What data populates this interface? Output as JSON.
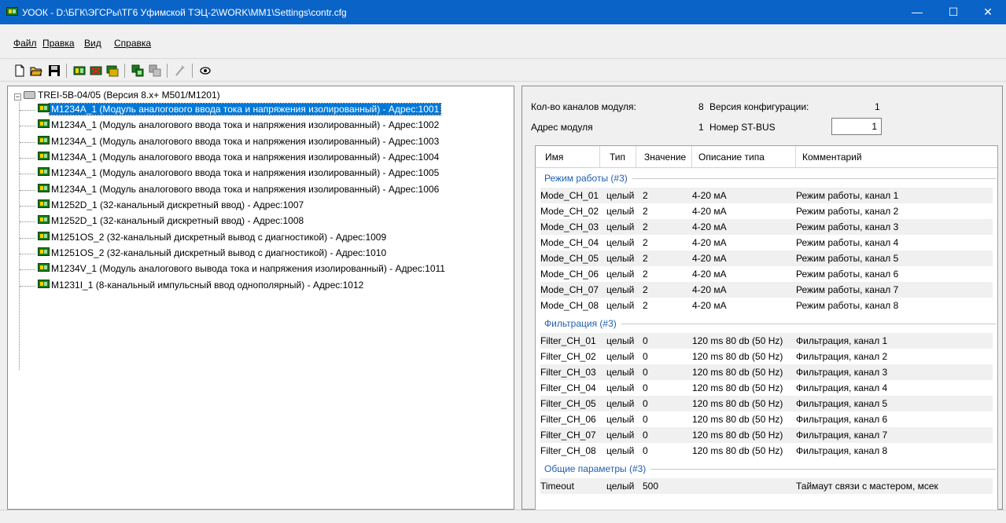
{
  "window": {
    "title": "УООК - D:\\БГК\\ЭГСРы\\ТГ6 Уфимской ТЭЦ-2\\WORK\\MM1\\Settings\\contr.cfg",
    "minimize_glyph": "—",
    "maximize_glyph": "☐",
    "close_glyph": "✕"
  },
  "menu": {
    "file": "Файл",
    "edit": "Правка",
    "view": "Вид",
    "help": "Справка"
  },
  "toolbar": {
    "icons": [
      "new-file-icon",
      "open-folder-icon",
      "save-icon",
      "module-add-icon",
      "module-delete-icon",
      "module-config-icon",
      "copy-icon",
      "paste-icon",
      "wand-icon",
      "eye-icon"
    ]
  },
  "tree": {
    "root": {
      "expander": "−",
      "label": "TREI-5B-04/05 (Версия 8.x+ M501/M1201)"
    },
    "items": [
      {
        "label": "M1234A_1 (Модуль аналогового ввода тока и напряжения изолированный) - Адрес:1001"
      },
      {
        "label": "M1234A_1 (Модуль аналогового ввода тока и напряжения изолированный) - Адрес:1002"
      },
      {
        "label": "M1234A_1 (Модуль аналогового ввода тока и напряжения изолированный) - Адрес:1003"
      },
      {
        "label": "M1234A_1 (Модуль аналогового ввода тока и напряжения изолированный) - Адрес:1004"
      },
      {
        "label": "M1234A_1 (Модуль аналогового ввода тока и напряжения изолированный) - Адрес:1005"
      },
      {
        "label": "M1234A_1 (Модуль аналогового ввода тока и напряжения изолированный) - Адрес:1006"
      },
      {
        "label": "M1252D_1 (32-канальный дискретный ввод) - Адрес:1007"
      },
      {
        "label": "M1252D_1 (32-канальный дискретный ввод) - Адрес:1008"
      },
      {
        "label": "M1251OS_2 (32-канальный дискретный вывод с диагностикой) - Адрес:1009"
      },
      {
        "label": "M1251OS_2 (32-канальный дискретный вывод с диагностикой) - Адрес:1010"
      },
      {
        "label": "M1234V_1 (Модуль аналогового вывода тока и напряжения изолированный) - Адрес:1011"
      },
      {
        "label": "M1231I_1 (8-канальный импульсный ввод однополярный) - Адрес:1012"
      }
    ]
  },
  "module_info": {
    "channels_label": "Кол-во каналов модуля:",
    "channels_value": "8",
    "config_version_label": "Версия конфигурации:",
    "config_version_value": "1",
    "address_label": "Адрес модуля",
    "address_value": "1",
    "stbus_label": "Номер ST-BUS",
    "stbus_value": "1"
  },
  "grid": {
    "headers": {
      "name": "Имя",
      "type": "Тип",
      "value": "Значение",
      "type_desc": "Описание типа",
      "comment": "Комментарий"
    },
    "groups": [
      {
        "title": "Режим работы (#3)",
        "rows": [
          {
            "name": "Mode_CH_01",
            "type": "целый",
            "value": "2",
            "desc": "4-20 мА",
            "comment": "Режим работы, канал 1"
          },
          {
            "name": "Mode_CH_02",
            "type": "целый",
            "value": "2",
            "desc": "4-20 мА",
            "comment": "Режим работы, канал 2"
          },
          {
            "name": "Mode_CH_03",
            "type": "целый",
            "value": "2",
            "desc": "4-20 мА",
            "comment": "Режим работы, канал 3"
          },
          {
            "name": "Mode_CH_04",
            "type": "целый",
            "value": "2",
            "desc": "4-20 мА",
            "comment": "Режим работы, канал 4"
          },
          {
            "name": "Mode_CH_05",
            "type": "целый",
            "value": "2",
            "desc": "4-20 мА",
            "comment": "Режим работы, канал 5"
          },
          {
            "name": "Mode_CH_06",
            "type": "целый",
            "value": "2",
            "desc": "4-20 мА",
            "comment": "Режим работы, канал 6"
          },
          {
            "name": "Mode_CH_07",
            "type": "целый",
            "value": "2",
            "desc": "4-20 мА",
            "comment": "Режим работы, канал 7"
          },
          {
            "name": "Mode_CH_08",
            "type": "целый",
            "value": "2",
            "desc": "4-20 мА",
            "comment": "Режим работы, канал 8"
          }
        ]
      },
      {
        "title": "Фильтрация (#3)",
        "rows": [
          {
            "name": "Filter_CH_01",
            "type": "целый",
            "value": "0",
            "desc": "120 ms 80 db (50 Hz)",
            "comment": "Фильтрация, канал 1"
          },
          {
            "name": "Filter_CH_02",
            "type": "целый",
            "value": "0",
            "desc": "120 ms 80 db (50 Hz)",
            "comment": "Фильтрация, канал 2"
          },
          {
            "name": "Filter_CH_03",
            "type": "целый",
            "value": "0",
            "desc": "120 ms 80 db (50 Hz)",
            "comment": "Фильтрация, канал 3"
          },
          {
            "name": "Filter_CH_04",
            "type": "целый",
            "value": "0",
            "desc": "120 ms 80 db (50 Hz)",
            "comment": "Фильтрация, канал 4"
          },
          {
            "name": "Filter_CH_05",
            "type": "целый",
            "value": "0",
            "desc": "120 ms 80 db (50 Hz)",
            "comment": "Фильтрация, канал 5"
          },
          {
            "name": "Filter_CH_06",
            "type": "целый",
            "value": "0",
            "desc": "120 ms 80 db (50 Hz)",
            "comment": "Фильтрация, канал 6"
          },
          {
            "name": "Filter_CH_07",
            "type": "целый",
            "value": "0",
            "desc": "120 ms 80 db (50 Hz)",
            "comment": "Фильтрация, канал 7"
          },
          {
            "name": "Filter_CH_08",
            "type": "целый",
            "value": "0",
            "desc": "120 ms 80 db (50 Hz)",
            "comment": "Фильтрация, канал 8"
          }
        ]
      },
      {
        "title": "Общие параметры (#3)",
        "rows": [
          {
            "name": "Timeout",
            "type": "целый",
            "value": "500",
            "desc": "",
            "comment": "Таймаут связи с мастером, мсек"
          }
        ]
      }
    ]
  },
  "colors": {
    "titlebar": "#0a64c8",
    "selection": "#0078d7",
    "group_title": "#1f5fb0"
  }
}
